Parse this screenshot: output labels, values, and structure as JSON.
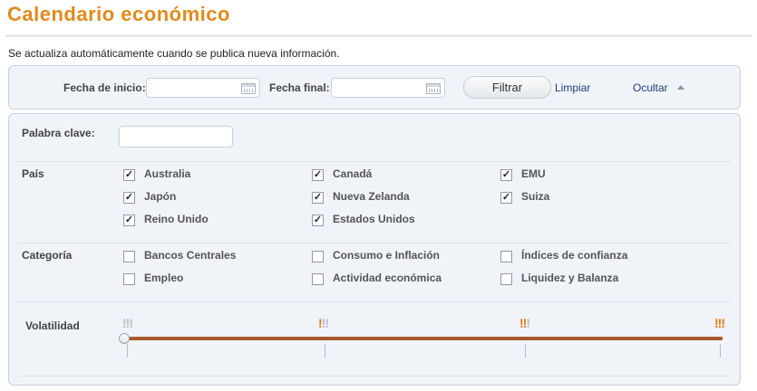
{
  "header": {
    "title": "Calendario económico",
    "subtitle": "Se actualiza automáticamente cuando se publica nueva información."
  },
  "filters": {
    "start_date_label": "Fecha de inicio:",
    "start_date_value": "",
    "end_date_label": "Fecha final:",
    "end_date_value": "",
    "filter_button": "Filtrar",
    "clear_link": "Limpiar",
    "hide_link": "Ocultar"
  },
  "keyword": {
    "label": "Palabra clave:",
    "value": ""
  },
  "country": {
    "label": "País",
    "items": [
      {
        "label": "Australia",
        "checked": true
      },
      {
        "label": "Canadá",
        "checked": true
      },
      {
        "label": "EMU",
        "checked": true
      },
      {
        "label": "Japón",
        "checked": true
      },
      {
        "label": "Nueva Zelanda",
        "checked": true
      },
      {
        "label": "Suiza",
        "checked": true
      },
      {
        "label": "Reino Unido",
        "checked": true
      },
      {
        "label": "Estados Unidos",
        "checked": true
      }
    ]
  },
  "category": {
    "label": "Categoría",
    "items": [
      {
        "label": "Bancos Centrales",
        "checked": false
      },
      {
        "label": "Consumo e Inflación",
        "checked": false
      },
      {
        "label": "Índices de confianza",
        "checked": false
      },
      {
        "label": "Empleo",
        "checked": false
      },
      {
        "label": "Actividad económica",
        "checked": false
      },
      {
        "label": "Liquidez y Balanza",
        "checked": false
      }
    ]
  },
  "volatility": {
    "label": "Volatilidad",
    "levels": [
      {
        "icon": "volatility-none-icon",
        "marks": "!!!",
        "active": 0
      },
      {
        "icon": "volatility-low-icon",
        "marks": "!!!",
        "active": 1
      },
      {
        "icon": "volatility-medium-icon",
        "marks": "!!!",
        "active": 2
      },
      {
        "icon": "volatility-high-icon",
        "marks": "!!!",
        "active": 3
      }
    ],
    "selected_min_level": 0,
    "selected_max_level": 3
  },
  "colors": {
    "title": "#e08a1e",
    "link": "#1f3f7a",
    "track": "#a65a2a",
    "active_mark": "#e07a10",
    "inactive_mark": "#b8bec8"
  }
}
